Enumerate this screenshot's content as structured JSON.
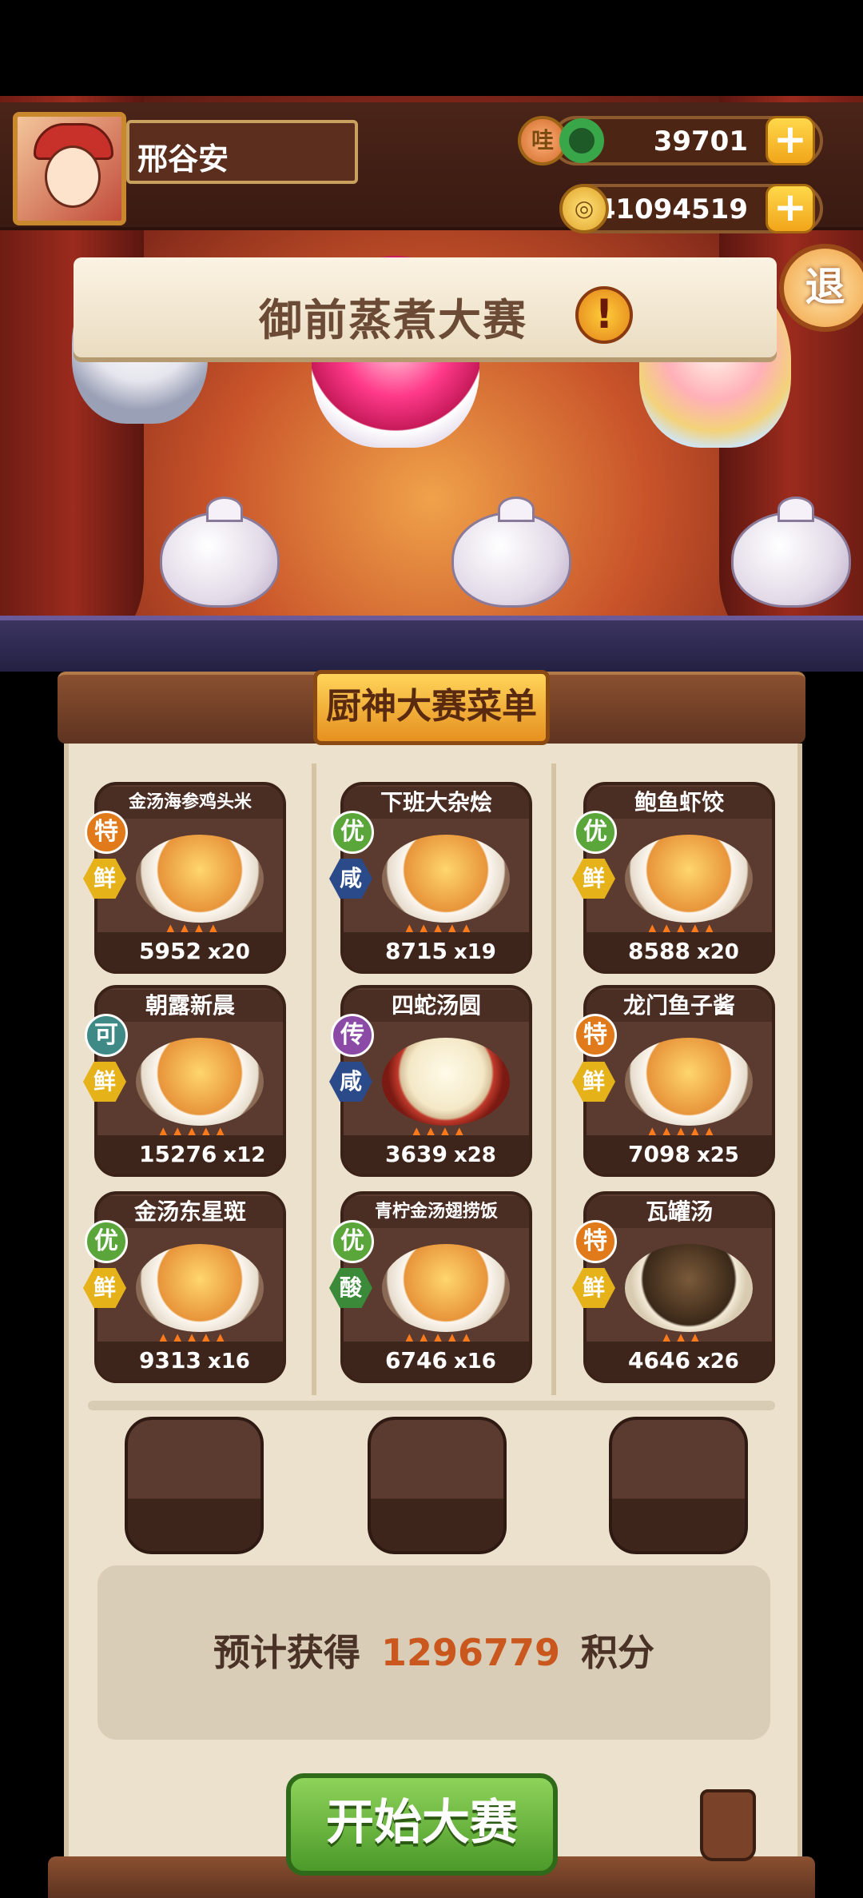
{
  "player": {
    "name": "邢谷安"
  },
  "currency": {
    "gems": {
      "icon": "哇",
      "value": "39701"
    },
    "coins": {
      "icon": "coin-icon",
      "value": "41094519"
    }
  },
  "buttons": {
    "exit": "退",
    "plus": "+",
    "start": "开始大赛"
  },
  "event": {
    "title": "御前蒸煮大赛",
    "alert": "!"
  },
  "menu": {
    "title": "厨神大赛菜单"
  },
  "dishes": [
    {
      "name": "金汤海参鸡头米",
      "grade": "特",
      "taste": "鲜",
      "price": "5952",
      "qty": "x20",
      "flames": 4
    },
    {
      "name": "下班大杂烩",
      "grade": "优",
      "taste": "咸",
      "price": "8715",
      "qty": "x19",
      "flames": 5
    },
    {
      "name": "鲍鱼虾饺",
      "grade": "优",
      "taste": "鲜",
      "price": "8588",
      "qty": "x20",
      "flames": 5
    },
    {
      "name": "朝露新晨",
      "grade": "可",
      "taste": "鲜",
      "price": "15276",
      "qty": "x12",
      "flames": 5
    },
    {
      "name": "四蛇汤圆",
      "grade": "传",
      "taste": "咸",
      "price": "3639",
      "qty": "x28",
      "flames": 4
    },
    {
      "name": "龙门鱼子酱",
      "grade": "特",
      "taste": "鲜",
      "price": "7098",
      "qty": "x25",
      "flames": 5
    },
    {
      "name": "金汤东星斑",
      "grade": "优",
      "taste": "鲜",
      "price": "9313",
      "qty": "x16",
      "flames": 5
    },
    {
      "name": "青柠金汤翅捞饭",
      "grade": "优",
      "taste": "酸",
      "price": "6746",
      "qty": "x16",
      "flames": 5
    },
    {
      "name": "瓦罐汤",
      "grade": "特",
      "taste": "鲜",
      "price": "4646",
      "qty": "x26",
      "flames": 3
    }
  ],
  "estimate": {
    "prefix": "预计获得",
    "value": "1296779",
    "suffix": "积分"
  },
  "colors": {
    "grade_te": "#e07a1a",
    "grade_you": "#5aa63a",
    "grade_ke": "#3f8a86",
    "grade_chuan": "#8a4aa6",
    "taste_xian": "#e6b21a",
    "taste_xian2": "#2a4a8a",
    "taste_suan": "#3a8a3a"
  }
}
